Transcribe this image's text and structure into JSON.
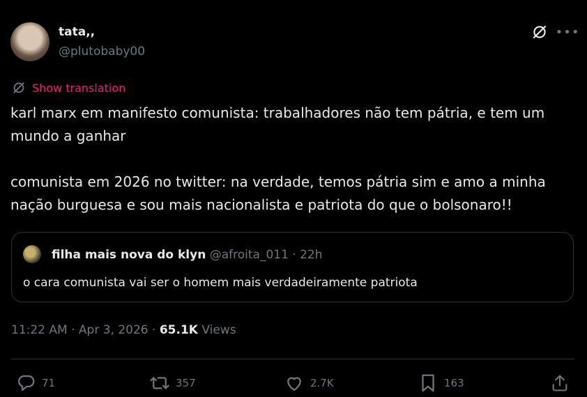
{
  "author": {
    "name": "tata,,",
    "handle": "@plutobaby00"
  },
  "translate": {
    "label": "Show translation",
    "color": "#f91880"
  },
  "tweet": {
    "paragraphs": [
      "karl marx em manifesto comunista: trabalhadores não tem pátria, e tem um mundo a ganhar",
      "comunista em 2026 no twitter: na verdade, temos pátria sim e amo a minha nação burguesa e sou mais nacionalista e patriota do que o bolsonaro!!"
    ]
  },
  "quote": {
    "name": "filha mais nova do klyn",
    "meta": "@afroita_011 · 22h",
    "text": "o cara comunista vai ser o homem mais verdadeiramente patriota"
  },
  "meta": {
    "time": "11:22 AM · Apr 3, 2026 · ",
    "views": "65.1K",
    "views_label": " Views"
  },
  "actions": {
    "replies": "71",
    "reposts": "357",
    "likes": "2.7K",
    "bookmarks": "163"
  },
  "icons": [
    "grok-icon",
    "more-icon",
    "translate-icon",
    "reply-icon",
    "repost-icon",
    "like-icon",
    "bookmark-icon",
    "share-icon"
  ]
}
